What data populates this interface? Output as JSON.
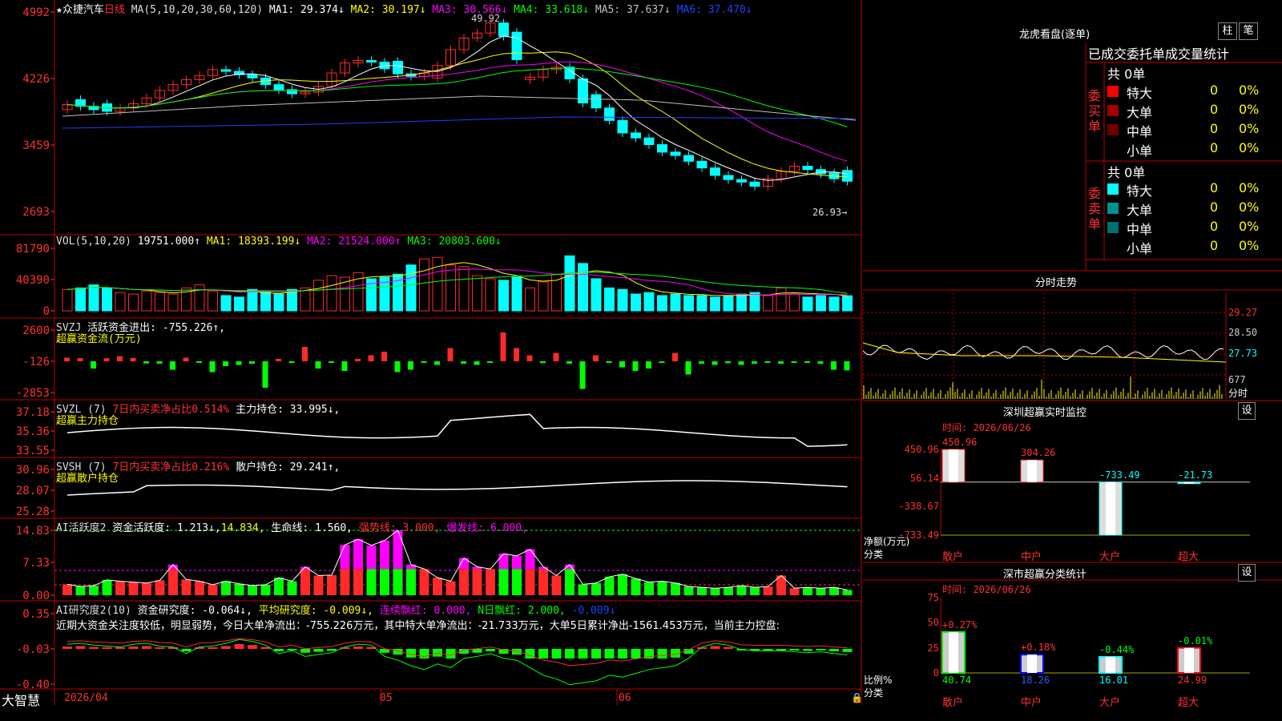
{
  "colors": {
    "up": "#ff2a2a",
    "down": "#00ffff",
    "ma1": "#ffffff",
    "ma2": "#ffff00",
    "ma3": "#ff00ff",
    "ma4": "#00ff00",
    "ma5": "#c0c0c0",
    "ma6": "#2040ff",
    "grid": "#b00000"
  },
  "main_panel": {
    "title_star": "★",
    "stock_name": "众捷汽车",
    "period": "日线",
    "ma_label": "MA(5,10,20,30,60,120)",
    "ma_values": [
      {
        "label": "MA1: 29.374↓",
        "color": "ma1"
      },
      {
        "label": "MA2: 30.197↓",
        "color": "ma2"
      },
      {
        "label": "MA3: 30.566↓",
        "color": "ma3"
      },
      {
        "label": "MA4: 33.618↓",
        "color": "ma4"
      },
      {
        "label": "MA5: 37.637↓",
        "color": "ma5"
      },
      {
        "label": "MA6: 37.470↓",
        "color": "ma6"
      }
    ],
    "y_ticks": [
      "4992",
      "4226",
      "3459",
      "2693"
    ],
    "high_marker": "49.92",
    "low_marker": "26.93→"
  },
  "vol_panel": {
    "label": "VOL(5,10,20)",
    "values": [
      {
        "label": "19751.000↑",
        "color": "ma1"
      },
      {
        "label": "MA1: 18393.199↓",
        "color": "ma2"
      },
      {
        "label": "MA2: 21524.000↑",
        "color": "ma3"
      },
      {
        "label": "MA3: 20803.600↓",
        "color": "ma4"
      }
    ],
    "y_ticks": [
      "81790",
      "40390",
      "0"
    ]
  },
  "svzj_panel": {
    "label": "SVZJ",
    "value": "活跃资金进出: -755.226↑,",
    "subtitle": "超赢资金流(万元)",
    "y_ticks": [
      "2600",
      "-126",
      "-2853"
    ]
  },
  "svzl_panel": {
    "label": "SVZL (7)",
    "value1": "7日内买卖净占比0.514%",
    "value2": "主力持仓: 33.995↓,",
    "subtitle": "超赢主力持仓",
    "y_ticks": [
      "37.18",
      "35.36",
      "33.55"
    ]
  },
  "svsh_panel": {
    "label": "SVSH (7)",
    "value1": "7日内买卖净占比0.216%",
    "value2": "散户持仓: 29.241↑,",
    "subtitle": "超赢散户持仓",
    "y_ticks": [
      "30.96",
      "28.07",
      "25.28"
    ]
  },
  "ai1_panel": {
    "label": "AI活跃度2",
    "v1": "资金活跃度: 1.213↓,",
    "v2": "14.834,",
    "v3": "生命线: 1.560,",
    "v4": "强势线: 3.000,",
    "v5": "爆发线: 6.000,",
    "y_ticks": [
      "14.83",
      "7.33",
      "0.00"
    ]
  },
  "ai2_panel": {
    "label": "AI研究度2(10)",
    "v1": "资金研究度: -0.064↓,",
    "v2": "平均研究度: -0.009↓,",
    "v3": "连续飘红: 0.000,",
    "v4": "N日飘红: 2.000,",
    "v5": "-0.009↓",
    "commentary": "近期大资金关注度较低，明显弱势，今日大单净流出：-755.226万元，其中特大单净流出：-21.733万元，大单5日累计净出-1561.453万元，当前主力控盘:",
    "y_ticks": [
      "0.35",
      "-0.03",
      "-0.40"
    ]
  },
  "bottom_bar": {
    "app_name": "大智慧",
    "dates": [
      "2026/04",
      "05",
      "06"
    ]
  },
  "lhb": {
    "title": "龙虎看盘(逐单)",
    "btn1": "柱",
    "btn2": "笔",
    "subtitle": "已成交委托单成交量统计",
    "buy_side": "委买单",
    "sell_side": "委卖单",
    "buy_total": "共 0单",
    "sell_total": "共 0单",
    "buy_rows": [
      {
        "label": "特大",
        "count": "0",
        "pct": "0%",
        "color": "#ff0000"
      },
      {
        "label": "大单",
        "count": "0",
        "pct": "0%",
        "color": "#a00000"
      },
      {
        "label": "中单",
        "count": "0",
        "pct": "0%",
        "color": "#700000"
      },
      {
        "label": "小单",
        "count": "0",
        "pct": "0%",
        "color": ""
      }
    ],
    "sell_rows": [
      {
        "label": "特大",
        "count": "0",
        "pct": "0%",
        "color": "#00ffff"
      },
      {
        "label": "大单",
        "count": "0",
        "pct": "0%",
        "color": "#009090"
      },
      {
        "label": "中单",
        "count": "0",
        "pct": "0%",
        "color": "#007070"
      },
      {
        "label": "小单",
        "count": "0",
        "pct": "0%",
        "color": ""
      }
    ]
  },
  "intraday": {
    "title": "分时走势",
    "y_ticks": [
      "29.27",
      "28.50",
      "27.73"
    ],
    "vol_tick": "677",
    "vol_label": "分时"
  },
  "realtime": {
    "title": "深圳超赢实时监控",
    "btn": "设",
    "time_label": "时间: 2026/06/26",
    "y_ticks": [
      "450.96",
      "56.14",
      "-338.67",
      "-733.49"
    ],
    "y_unit": "净额(万元)",
    "x_unit": "分类",
    "bars": [
      {
        "cat": "散户",
        "value": 450.96,
        "label": "450.96"
      },
      {
        "cat": "中户",
        "value": 304.26,
        "label": "304.26"
      },
      {
        "cat": "大户",
        "value": -733.49,
        "label": "-733.49"
      },
      {
        "cat": "超大",
        "value": -21.73,
        "label": "-21.73"
      }
    ]
  },
  "classify": {
    "title": "深市超赢分类统计",
    "btn": "设",
    "time_label": "时间: 2026/06/26",
    "y_ticks": [
      "75",
      "50",
      "25",
      "0"
    ],
    "y_unit": "比例%",
    "x_unit": "分类",
    "bars": [
      {
        "cat": "散户",
        "value": 40.74,
        "label": "40.74",
        "delta": "+0.27%",
        "color": "#ffffff",
        "edge": "#00ff00"
      },
      {
        "cat": "中户",
        "value": 18.26,
        "label": "18.26",
        "delta": "+0.18%",
        "color": "#ffffff",
        "edge": "#0000ff"
      },
      {
        "cat": "大户",
        "value": 16.01,
        "label": "16.01",
        "delta": "-0.44%",
        "color": "#ffffff",
        "edge": "#00ffff"
      },
      {
        "cat": "超大",
        "value": 24.99,
        "label": "24.99",
        "delta": "-0.01%",
        "color": "#ffffff",
        "edge": "#ff0000"
      }
    ]
  }
}
